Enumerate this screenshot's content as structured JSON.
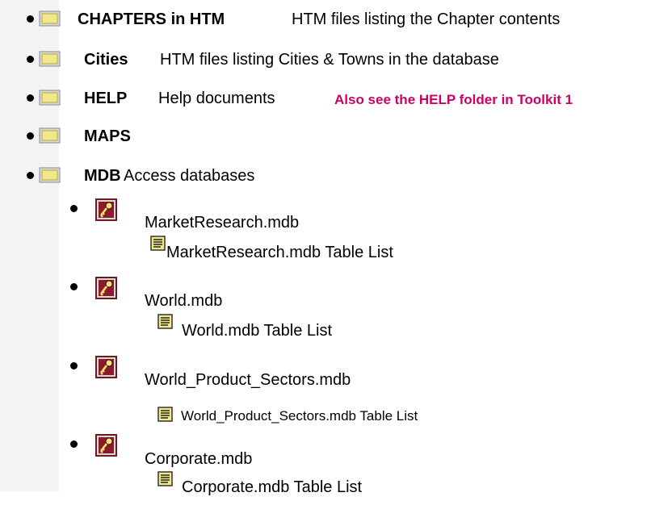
{
  "folders": [
    {
      "name": "CHAPTERS in HTM",
      "desc": "HTM files listing the Chapter contents",
      "note": ""
    },
    {
      "name": "Cities",
      "desc": "HTM files listing Cities & Towns in the database",
      "note": ""
    },
    {
      "name": "HELP",
      "desc": "Help documents",
      "note": "Also see the HELP folder in Toolkit 1"
    },
    {
      "name": "MAPS",
      "desc": "",
      "note": ""
    },
    {
      "name": "MDB",
      "desc": "Access databases",
      "note": ""
    }
  ],
  "databases": [
    {
      "file": "MarketResearch.mdb",
      "table_list": "MarketResearch.mdb Table List"
    },
    {
      "file": "World.mdb",
      "table_list": "World.mdb Table List"
    },
    {
      "file": "World_Product_Sectors.mdb",
      "table_list": "World_Product_Sectors.mdb Table List"
    },
    {
      "file": "Corporate.mdb",
      "table_list": "Corporate.mdb Table List"
    }
  ],
  "icons": {
    "folder": "folder-icon",
    "database": "access-database-icon",
    "document": "document-icon"
  },
  "colors": {
    "note": "#cc0066",
    "gutter": "#f3f3f3",
    "folder_fill": "#f2e88a",
    "access_red": "#8b1a2a"
  }
}
